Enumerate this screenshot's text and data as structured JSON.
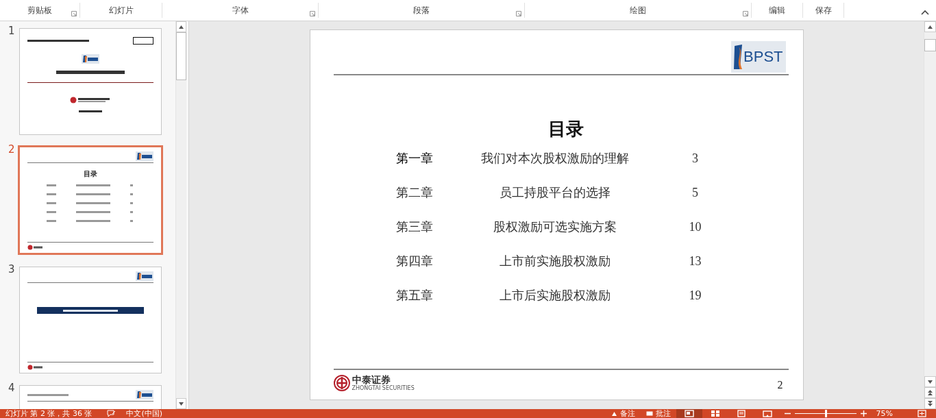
{
  "ribbon": {
    "groups": [
      {
        "label": "剪贴板",
        "launcher": true
      },
      {
        "label": "幻灯片",
        "launcher": false
      },
      {
        "label": "字体",
        "launcher": true
      },
      {
        "label": "段落",
        "launcher": true
      },
      {
        "label": "绘图",
        "launcher": true
      },
      {
        "label": "编辑",
        "launcher": false
      },
      {
        "label": "保存",
        "launcher": false
      }
    ]
  },
  "thumbnails": [
    {
      "number": "1",
      "kind": "cover",
      "selected": false
    },
    {
      "number": "2",
      "kind": "toc",
      "selected": true,
      "title": "目录"
    },
    {
      "number": "3",
      "kind": "section",
      "selected": false
    },
    {
      "number": "4",
      "kind": "content",
      "selected": false
    }
  ],
  "slide": {
    "logo_text": "BPST",
    "title": "目录",
    "rows": [
      {
        "chapter": "第一章",
        "topic": "我们对本次股权激励的理解",
        "page": "3",
        "highlighted": true
      },
      {
        "chapter": "第二章",
        "topic": "员工持股平台的选择",
        "page": "5",
        "highlighted": false
      },
      {
        "chapter": "第三章",
        "topic": "股权激励可选实施方案",
        "page": "10",
        "highlighted": false
      },
      {
        "chapter": "第四章",
        "topic": "上市前实施股权激励",
        "page": "13",
        "highlighted": false
      },
      {
        "chapter": "第五章",
        "topic": "上市后实施股权激励",
        "page": "19",
        "highlighted": false
      }
    ],
    "footer": {
      "company": "中泰证券",
      "company_en": "ZHONGTAI SECURITIES",
      "page_number": "2"
    }
  },
  "status_bar": {
    "slide_info": "幻灯片 第 2 张，共 36 张",
    "language": "中文(中国)",
    "notes": "备注",
    "comments": "批注",
    "views": [
      {
        "selected": true
      },
      {
        "selected": false
      },
      {
        "selected": false
      },
      {
        "selected": false
      }
    ],
    "zoom_slider": {
      "level": 0.5
    },
    "zoom": "75%"
  }
}
